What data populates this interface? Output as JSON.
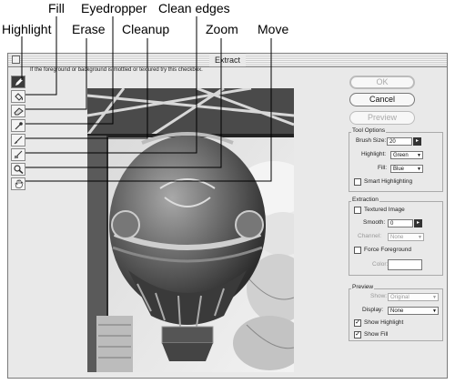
{
  "callouts": {
    "fill": "Fill",
    "eyedropper": "Eyedropper",
    "clean_edges": "Clean edges",
    "highlight": "Highlight",
    "erase": "Erase",
    "cleanup": "Cleanup",
    "zoom": "Zoom",
    "move": "Move"
  },
  "window": {
    "title": "Extract",
    "hint": "If the foreground or background is mottled or textured try this checkbox."
  },
  "tools": [
    {
      "name": "highlighter-tool",
      "icon": "marker-icon",
      "active": true
    },
    {
      "name": "fill-tool",
      "icon": "paint-bucket-icon",
      "active": false
    },
    {
      "name": "eraser-tool",
      "icon": "eraser-icon",
      "active": false
    },
    {
      "name": "eyedropper-tool",
      "icon": "eyedropper-icon",
      "active": false
    },
    {
      "name": "cleanup-tool",
      "icon": "cleanup-brush-icon",
      "active": false
    },
    {
      "name": "edge-touchup-tool",
      "icon": "edge-touchup-icon",
      "active": false
    },
    {
      "name": "zoom-tool",
      "icon": "magnifier-icon",
      "active": false
    },
    {
      "name": "hand-tool",
      "icon": "hand-icon",
      "active": false
    }
  ],
  "buttons": {
    "ok": "OK",
    "cancel": "Cancel",
    "preview": "Preview"
  },
  "tool_options": {
    "title": "Tool Options",
    "brush_size_label": "Brush Size:",
    "brush_size_value": "20",
    "highlight_label": "Highlight:",
    "highlight_value": "Green",
    "fill_label": "Fill:",
    "fill_value": "Blue",
    "smart_highlighting_label": "Smart Highlighting",
    "smart_highlighting_checked": false
  },
  "extraction": {
    "title": "Extraction",
    "textured_image_label": "Textured Image",
    "textured_image_checked": false,
    "smooth_label": "Smooth:",
    "smooth_value": "0",
    "channel_label": "Channel:",
    "channel_value": "None",
    "force_foreground_label": "Force Foreground",
    "force_foreground_checked": false,
    "color_label": "Color:"
  },
  "preview_group": {
    "title": "Preview",
    "show_label": "Show:",
    "show_value": "Original",
    "display_label": "Display:",
    "display_value": "None",
    "show_highlight_label": "Show Highlight",
    "show_highlight_checked": true,
    "show_fill_label": "Show Fill",
    "show_fill_checked": true
  },
  "colors": {
    "window_bg": "#e9e9e9",
    "active_tool": "#3c3c3c"
  }
}
